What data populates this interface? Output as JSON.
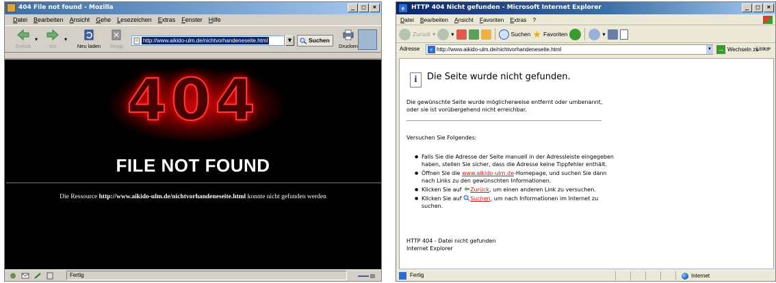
{
  "left_window": {
    "title": "404 File not found - Mozilla",
    "menu": [
      "Datei",
      "Bearbeiten",
      "Ansicht",
      "Gehe",
      "Lesezeichen",
      "Extras",
      "Fenster",
      "Hilfe"
    ],
    "toolbar": {
      "back": "Zurück",
      "forward": "Vor",
      "reload": "Neu laden",
      "stop": "Stopp",
      "url": "http://www.aikido-ulm.de/nichtvorhandeneseite.html",
      "search": "Suchen",
      "print": "Drucken"
    },
    "page": {
      "code": "404",
      "heading": "FILE NOT FOUND",
      "message_prefix": "Die Ressource",
      "message_url": "http://www.aikido-ulm.de/nichtvorhandeneseite.html",
      "message_suffix": "konnte nicht gefunden werden"
    },
    "status": "Fertig"
  },
  "right_window": {
    "title": "HTTP 404 Nicht gefunden - Microsoft Internet Explorer",
    "menu": [
      "Datei",
      "Bearbeiten",
      "Ansicht",
      "Favoriten",
      "Extras",
      "?"
    ],
    "toolbar": {
      "back": "Zurück",
      "search": "Suchen",
      "favorites": "Favoriten"
    },
    "address": {
      "label": "Adresse",
      "url": "http://www.aikido-ulm.de/nichtvorhandeneseite.html",
      "go": "Wechseln zu",
      "links": "Links"
    },
    "page": {
      "headline": "Die Seite wurde nicht gefunden.",
      "intro": "Die gewünschte Seite wurde möglicherweise entfernt oder umbenannt, oder sie ist vorübergehend nicht erreichbar.",
      "try_heading": "Versuchen Sie Folgendes:",
      "tip1": "Falls Sie die Adresse der Seite manuell in der Adressleiste eingegeben haben, stellen Sie sicher, dass die Adresse keine Tippfehler enthält.",
      "tip2_prefix": "Öffnen Sie die",
      "tip2_link": "www.aikido-ulm.de",
      "tip2_suffix": "-Homepage, und suchen Sie dann nach Links zu den gewünschten Informationen.",
      "tip3_prefix": "Klicken Sie auf",
      "tip3_link": "Zurück",
      "tip3_suffix": ", um einen anderen Link zu versuchen.",
      "tip4_prefix": "Klicken Sie auf",
      "tip4_link": "Suchen",
      "tip4_suffix": ", um nach Informationen im Internet zu suchen.",
      "error_line": "HTTP 404 - Datei nicht gefunden",
      "product_line": "Internet Explorer"
    },
    "status": "Fertig",
    "zone": "Internet"
  },
  "colors": {
    "glow_red": "#ff0000",
    "link_red": "#d41414",
    "selection_blue": "#0a246a"
  }
}
